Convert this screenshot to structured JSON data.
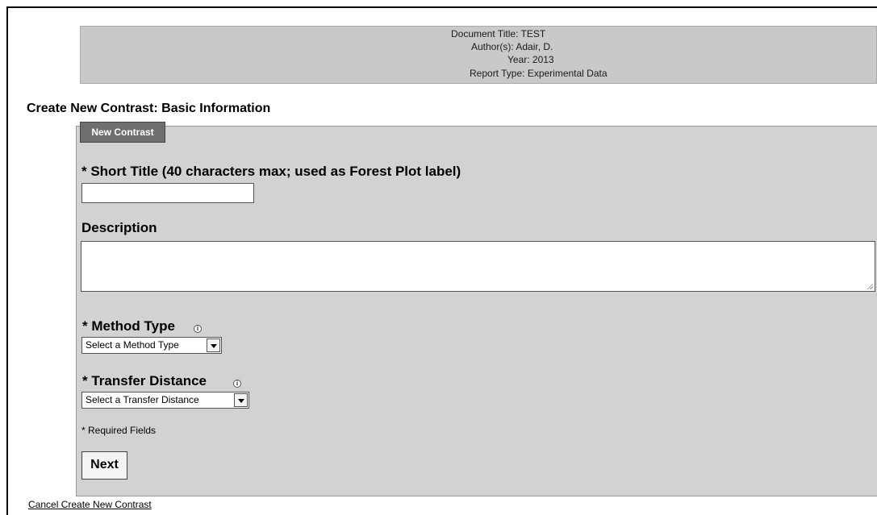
{
  "document_header": {
    "title_line": "Document Title: TEST",
    "authors_line": "Author(s): Adair, D.",
    "year_line": "Year: 2013",
    "report_type_line": "Report Type: Experimental Data"
  },
  "section_title": "Create New Contrast: Basic Information",
  "form": {
    "legend": "New Contrast",
    "short_title": {
      "label": "* Short Title (40 characters max; used as Forest Plot label)",
      "value": ""
    },
    "description": {
      "label": "Description",
      "value": ""
    },
    "method_type": {
      "label": "* Method Type",
      "selected": "Select a Method Type",
      "info_icon": "info-icon"
    },
    "transfer_distance": {
      "label": "* Transfer Distance",
      "selected": "Select a Transfer Distance",
      "info_icon": "info-icon"
    },
    "required_note": "* Required Fields",
    "next_label": "Next"
  },
  "cancel_link": "Cancel Create New Contrast",
  "colors": {
    "header_bg": "#c9c9c9",
    "panel_bg": "#d2d2d2",
    "legend_bg": "#6f6f6f"
  }
}
